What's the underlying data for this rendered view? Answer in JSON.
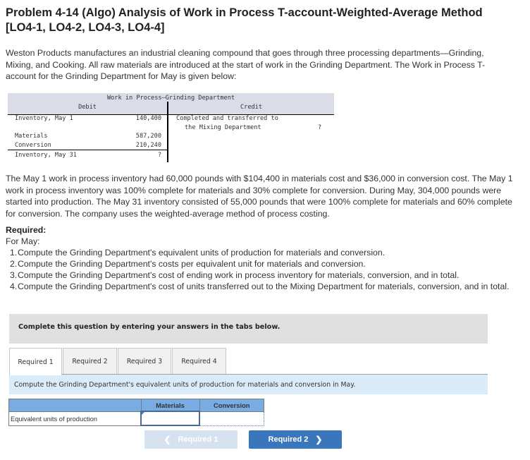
{
  "problem": {
    "title": "Problem 4-14 (Algo) Analysis of Work in Process T-account-Weighted-Average Method [LO4-1, LO4-2, LO4-3, LO4-4]",
    "intro": "Weston Products manufactures an industrial cleaning compound that goes through three processing departments—Grinding, Mixing, and Cooking. All raw materials are introduced at the start of work in the Grinding Department. The Work in Process T-account for the Grinding Department for May is given below:",
    "details": "The May 1 work in process inventory had 60,000 pounds with $104,400 in materials cost and $36,000 in conversion cost. The May 1 work in process inventory was 100% complete for materials and 30% complete for conversion. During May, 304,000 pounds were started into production. The May 31 inventory consisted of 55,000 pounds that were 100% complete for materials and 60% complete for conversion. The company uses the weighted-average method of process costing."
  },
  "t_account": {
    "title": "Work in Process–Grinding Department",
    "debit_label": "Debit",
    "credit_label": "Credit",
    "debit_rows": [
      {
        "label": "Inventory, May 1",
        "value": "140,400"
      },
      {
        "label": "Materials",
        "value": "587,200"
      },
      {
        "label": "Conversion",
        "value": "210,240"
      },
      {
        "label": "Inventory, May 31",
        "value": "?"
      }
    ],
    "credit_rows": [
      {
        "label_line1": "Completed and transferred to",
        "label_line2": "the Mixing Department",
        "value": "?"
      }
    ]
  },
  "required": {
    "label": "Required:",
    "for": "For May:",
    "items": [
      {
        "num": "1.",
        "text": "Compute the Grinding Department's equivalent units of production for materials and conversion."
      },
      {
        "num": "2.",
        "text": "Compute the Grinding Department's costs per equivalent unit for materials and conversion."
      },
      {
        "num": "3.",
        "text": "Compute the Grinding Department's cost of ending work in process inventory for materials, conversion, and in total."
      },
      {
        "num": "4.",
        "text": "Compute the Grinding Department's cost of units transferred out to the Mixing Department for materials, conversion, and in total."
      }
    ]
  },
  "answer_area": {
    "instruction": "Complete this question by entering your answers in the tabs below.",
    "tabs": [
      {
        "label": "Required 1",
        "active": true
      },
      {
        "label": "Required 2",
        "active": false
      },
      {
        "label": "Required 3",
        "active": false
      },
      {
        "label": "Required 4",
        "active": false
      }
    ],
    "info": "Compute the Grinding Department's equivalent units of production for materials and conversion in May.",
    "table": {
      "headers": [
        "",
        "Materials",
        "Conversion"
      ],
      "rows": [
        {
          "label": "Equivalent units of production",
          "materials": "",
          "conversion": ""
        }
      ]
    },
    "nav": {
      "prev_label": "Required 1",
      "next_label": "Required 2",
      "prev_icon": "chevron-left-icon",
      "next_icon": "chevron-right-icon"
    },
    "colors": {
      "table_header": "#79ace2",
      "next_button": "#3a76bb",
      "prev_button_disabled": "#d6e2ef",
      "info_bar": "#daecf9",
      "instruction_bar": "#e0e0e0"
    }
  }
}
